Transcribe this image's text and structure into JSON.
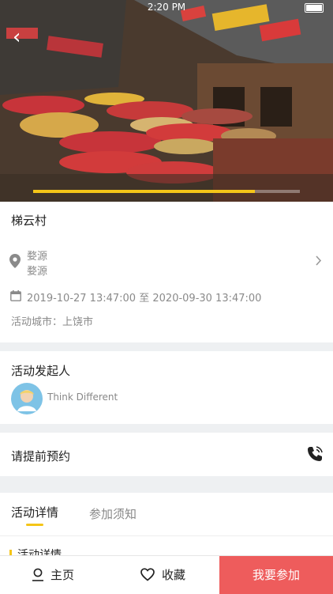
{
  "status": {
    "time": "2:20 PM"
  },
  "hero": {
    "progress_ratio": 0.83
  },
  "event": {
    "title": "梯云村",
    "location_line1": "婺源",
    "location_line2": "婺源",
    "date_start": "2019-10-27 13:47:00",
    "date_sep": "至",
    "date_end": "2020-09-30 13:47:00",
    "city_label": "活动城市：",
    "city_value": "上饶市"
  },
  "organizer": {
    "section_title": "活动发起人",
    "name": "Think Different"
  },
  "reservation": {
    "text": "请提前预约"
  },
  "tabs": [
    {
      "label": "活动详情",
      "active": true
    },
    {
      "label": "参加须知",
      "active": false
    }
  ],
  "details_heading": "活动详情",
  "bottom_bar": {
    "home_label": "主页",
    "favorite_label": "收藏",
    "join_label": "我要参加"
  },
  "colors": {
    "accent_yellow": "#f5c518",
    "join_red": "#ee5c5c"
  },
  "icons": [
    "back-icon",
    "location-pin-icon",
    "chevron-right-icon",
    "calendar-icon",
    "phone-icon",
    "home-icon",
    "heart-icon",
    "avatar"
  ]
}
